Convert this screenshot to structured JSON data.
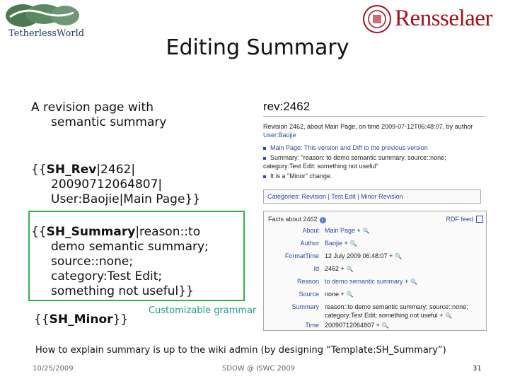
{
  "logos": {
    "left_text": "TetherlessWorld",
    "right_text": "Rensselaer"
  },
  "slide": {
    "title": "Editing Summary",
    "bullet1": [
      "A revision page with",
      "semantic summary"
    ],
    "sh_rev": {
      "open": "{{",
      "name": "SH_Rev",
      "line1_rest": "|2462|",
      "line2": "20090712064807|",
      "line3": "User:Baojie|Main Page}}"
    },
    "sh_summary": {
      "open": "{{",
      "name": "SH_Summary",
      "line1_rest": "|reason::to",
      "line2": "demo semantic summary;",
      "line3": "source::none;",
      "line4": "category:Test Edit;",
      "line5": "something not useful}}"
    },
    "sh_minor": {
      "open": "{{",
      "name": "SH_Minor",
      "close": "}}"
    },
    "grammar_label": "Customizable grammar",
    "bottom_note": "How to explain summary is up to the wiki admin (by designing “Template:SH_Summary”)"
  },
  "wiki": {
    "title": "rev:2462",
    "line1": "Revision 2462, about Main Page, on time 2009-07-12T06:48:07, by author",
    "line2": "User:Baojie",
    "bullet1": "Main Page: This version and Diff to the previous version",
    "bullet2a": "Summary: \"reason: to demo semantic summary, source::none;",
    "bullet2b": "category:Test Edit: something not useful\"",
    "bullet3": "It is a \"Minor\" change.",
    "categories": "Categories: Revision | Test Edit | Minor Revision",
    "facts_title": "Facts about 2462",
    "rdf_feed": "RDF feed",
    "facts": [
      {
        "key": "About",
        "value": "Main Page"
      },
      {
        "key": "Author",
        "value": "Baojie"
      },
      {
        "key": "FormatTime",
        "value": "12 July 2009 06:48:07"
      },
      {
        "key": "Id",
        "value": "2462"
      },
      {
        "key": "Reason",
        "value": "to demo semantic summary"
      },
      {
        "key": "Source",
        "value": "none"
      },
      {
        "key": "Summary",
        "value": "reason::to demo semantic summary; source::none;"
      },
      {
        "key": "",
        "value": "category:Test Edit; something not useful"
      },
      {
        "key": "Time",
        "value": "20090712064807"
      }
    ],
    "plus": "+"
  },
  "footer": {
    "date": "10/25/2009",
    "venue": "SDOW @ ISWC 2009",
    "page": "31"
  }
}
